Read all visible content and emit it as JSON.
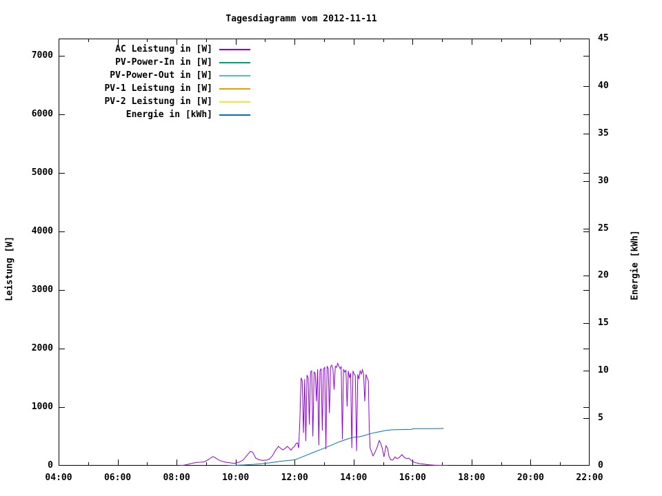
{
  "window": {
    "background": "#ffffff"
  },
  "chart": {
    "title": "Tagesdiagramm vom 2012-11-11",
    "left_axis_label": "Leistung [W]",
    "right_axis_label": "Energie [kWh]"
  },
  "chart_data": {
    "type": "line",
    "title": "Tagesdiagramm vom 2012-11-11",
    "xlabel": "",
    "x_axis": {
      "unit": "time of day",
      "range_hours": [
        4,
        22
      ],
      "major_tick_hours": [
        4,
        6,
        8,
        10,
        12,
        14,
        16,
        18,
        20,
        22
      ],
      "major_tick_labels": [
        "04:00",
        "06:00",
        "08:00",
        "10:00",
        "12:00",
        "14:00",
        "16:00",
        "18:00",
        "20:00",
        "22:00"
      ],
      "minor_tick_every_hours": 1
    },
    "y_axis_left": {
      "label": "Leistung [W]",
      "range": [
        0,
        7300
      ],
      "tick_values": [
        0,
        1000,
        2000,
        3000,
        4000,
        5000,
        6000,
        7000
      ],
      "tick_labels": [
        "0",
        "1000",
        "2000",
        "3000",
        "4000",
        "5000",
        "6000",
        "7000"
      ]
    },
    "y_axis_right": {
      "label": "Energie [kWh]",
      "range": [
        0,
        45
      ],
      "tick_values": [
        0,
        5,
        10,
        15,
        20,
        25,
        30,
        35,
        40,
        45
      ],
      "tick_labels": [
        "0",
        "5",
        "10",
        "15",
        "20",
        "25",
        "30",
        "35",
        "40",
        "45"
      ]
    },
    "grid": false,
    "legend_position": "top-left-inside",
    "series": [
      {
        "name": "AC Leistung in [W]",
        "color": "#9400d3",
        "axis": "left",
        "points": [
          [
            8.1,
            0
          ],
          [
            8.25,
            10
          ],
          [
            8.4,
            25
          ],
          [
            8.55,
            45
          ],
          [
            8.7,
            55
          ],
          [
            8.85,
            60
          ],
          [
            8.95,
            70
          ],
          [
            9.05,
            95
          ],
          [
            9.15,
            130
          ],
          [
            9.23,
            155
          ],
          [
            9.3,
            140
          ],
          [
            9.4,
            105
          ],
          [
            9.5,
            80
          ],
          [
            9.65,
            60
          ],
          [
            9.8,
            50
          ],
          [
            9.95,
            40
          ],
          [
            10.1,
            55
          ],
          [
            10.25,
            95
          ],
          [
            10.4,
            185
          ],
          [
            10.5,
            245
          ],
          [
            10.58,
            230
          ],
          [
            10.68,
            130
          ],
          [
            10.8,
            100
          ],
          [
            10.92,
            90
          ],
          [
            11.05,
            95
          ],
          [
            11.15,
            115
          ],
          [
            11.25,
            170
          ],
          [
            11.35,
            260
          ],
          [
            11.45,
            330
          ],
          [
            11.52,
            300
          ],
          [
            11.6,
            270
          ],
          [
            11.68,
            295
          ],
          [
            11.75,
            330
          ],
          [
            11.82,
            300
          ],
          [
            11.88,
            265
          ],
          [
            11.94,
            310
          ],
          [
            12.0,
            330
          ],
          [
            12.05,
            380
          ],
          [
            12.1,
            390
          ],
          [
            12.14,
            300
          ],
          [
            12.18,
            800
          ],
          [
            12.22,
            1500
          ],
          [
            12.26,
            1450
          ],
          [
            12.3,
            560
          ],
          [
            12.34,
            1480
          ],
          [
            12.38,
            420
          ],
          [
            12.42,
            1550
          ],
          [
            12.46,
            1500
          ],
          [
            12.5,
            700
          ],
          [
            12.54,
            1600
          ],
          [
            12.58,
            1620
          ],
          [
            12.62,
            500
          ],
          [
            12.66,
            1600
          ],
          [
            12.7,
            1580
          ],
          [
            12.74,
            1100
          ],
          [
            12.78,
            1650
          ],
          [
            12.82,
            350
          ],
          [
            12.86,
            1620
          ],
          [
            12.9,
            1660
          ],
          [
            12.94,
            600
          ],
          [
            12.98,
            1650
          ],
          [
            13.02,
            1680
          ],
          [
            13.06,
            280
          ],
          [
            13.1,
            1700
          ],
          [
            13.14,
            1660
          ],
          [
            13.18,
            900
          ],
          [
            13.22,
            1690
          ],
          [
            13.26,
            1720
          ],
          [
            13.3,
            1650
          ],
          [
            13.34,
            1300
          ],
          [
            13.38,
            1700
          ],
          [
            13.42,
            1680
          ],
          [
            13.46,
            1750
          ],
          [
            13.5,
            1700
          ],
          [
            13.54,
            1660
          ],
          [
            13.58,
            1690
          ],
          [
            13.62,
            450
          ],
          [
            13.66,
            1650
          ],
          [
            13.7,
            1600
          ],
          [
            13.74,
            1630
          ],
          [
            13.78,
            1010
          ],
          [
            13.82,
            1620
          ],
          [
            13.86,
            1500
          ],
          [
            13.9,
            1580
          ],
          [
            13.94,
            300
          ],
          [
            13.98,
            1620
          ],
          [
            14.02,
            1560
          ],
          [
            14.06,
            1540
          ],
          [
            14.1,
            250
          ],
          [
            14.14,
            1560
          ],
          [
            14.18,
            1480
          ],
          [
            14.22,
            1620
          ],
          [
            14.26,
            1570
          ],
          [
            14.3,
            1640
          ],
          [
            14.34,
            1560
          ],
          [
            14.38,
            1100
          ],
          [
            14.42,
            1560
          ],
          [
            14.46,
            1500
          ],
          [
            14.5,
            1450
          ],
          [
            14.53,
            700
          ],
          [
            14.56,
            300
          ],
          [
            14.6,
            250
          ],
          [
            14.66,
            170
          ],
          [
            14.7,
            200
          ],
          [
            14.75,
            260
          ],
          [
            14.8,
            320
          ],
          [
            14.87,
            430
          ],
          [
            14.92,
            380
          ],
          [
            14.97,
            300
          ],
          [
            15.03,
            150
          ],
          [
            15.1,
            340
          ],
          [
            15.15,
            300
          ],
          [
            15.2,
            160
          ],
          [
            15.26,
            100
          ],
          [
            15.33,
            95
          ],
          [
            15.4,
            150
          ],
          [
            15.47,
            120
          ],
          [
            15.55,
            140
          ],
          [
            15.64,
            190
          ],
          [
            15.72,
            140
          ],
          [
            15.8,
            120
          ],
          [
            15.87,
            130
          ],
          [
            15.95,
            90
          ],
          [
            16.05,
            60
          ],
          [
            16.11,
            50
          ],
          [
            16.25,
            35
          ],
          [
            16.4,
            25
          ],
          [
            16.55,
            15
          ],
          [
            16.75,
            8
          ],
          [
            17.0,
            4
          ],
          [
            17.2,
            0
          ]
        ]
      },
      {
        "name": "PV-Power-In in [W]",
        "color": "#009e73",
        "axis": "left",
        "points": []
      },
      {
        "name": "PV-Power-Out in [W]",
        "color": "#56b4e9",
        "axis": "left",
        "points": []
      },
      {
        "name": "PV-1 Leistung in [W]",
        "color": "#e69f00",
        "axis": "left",
        "points": []
      },
      {
        "name": "PV-2 Leistung in [W]",
        "color": "#f0e442",
        "axis": "left",
        "points": []
      },
      {
        "name": "Energie in [kWh]",
        "color": "#0072b2",
        "axis": "right",
        "points": [
          [
            9.72,
            0
          ],
          [
            10.0,
            0.04
          ],
          [
            10.3,
            0.08
          ],
          [
            10.6,
            0.14
          ],
          [
            10.9,
            0.22
          ],
          [
            11.2,
            0.32
          ],
          [
            11.5,
            0.45
          ],
          [
            11.8,
            0.55
          ],
          [
            12.0,
            0.62
          ],
          [
            12.2,
            0.85
          ],
          [
            12.4,
            1.1
          ],
          [
            12.6,
            1.35
          ],
          [
            12.9,
            1.72
          ],
          [
            13.2,
            2.1
          ],
          [
            13.5,
            2.5
          ],
          [
            13.8,
            2.82
          ],
          [
            14.0,
            3.0
          ],
          [
            14.2,
            3.05
          ],
          [
            14.33,
            3.15
          ],
          [
            14.55,
            3.35
          ],
          [
            14.75,
            3.5
          ],
          [
            14.95,
            3.62
          ],
          [
            15.1,
            3.72
          ],
          [
            15.3,
            3.78
          ],
          [
            15.6,
            3.8
          ],
          [
            15.95,
            3.82
          ],
          [
            16.02,
            3.9
          ],
          [
            16.6,
            3.9
          ],
          [
            17.05,
            3.92
          ]
        ]
      }
    ]
  }
}
